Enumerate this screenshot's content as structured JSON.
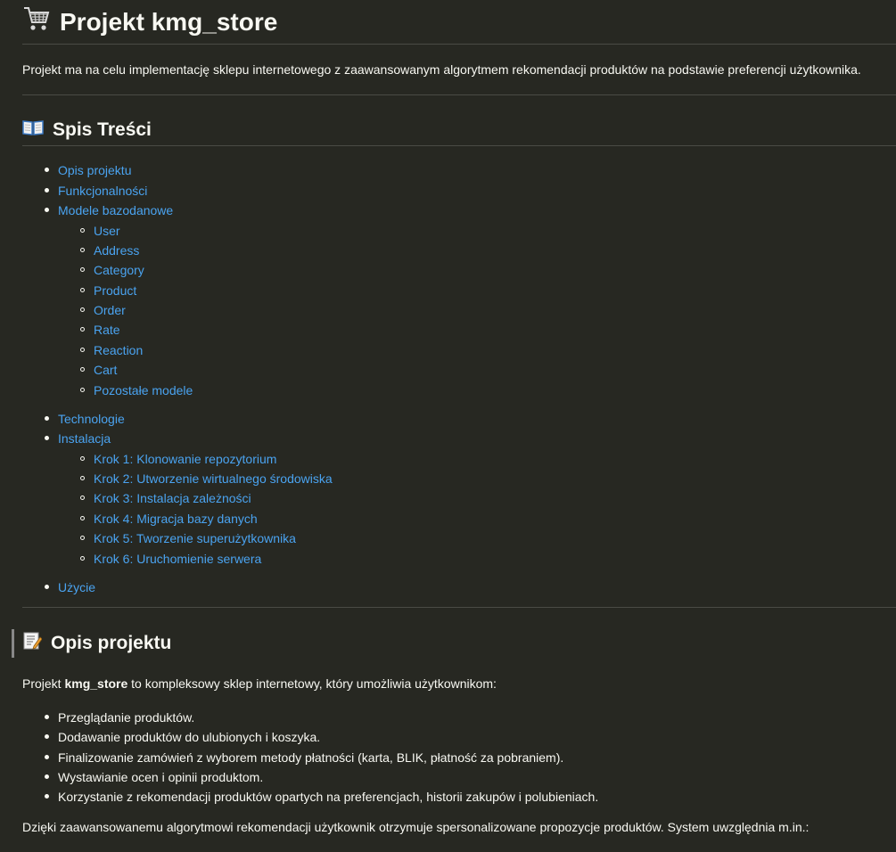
{
  "title": "Projekt kmg_store",
  "intro": "Projekt ma na celu implementację sklepu internetowego z zaawansowanym algorytmem rekomendacji produktów na podstawie preferencji użytkownika.",
  "toc": {
    "heading": "Spis Treści",
    "items": [
      {
        "label": "Opis projektu"
      },
      {
        "label": "Funkcjonalności"
      },
      {
        "label": "Modele bazodanowe"
      },
      {
        "label": "User"
      },
      {
        "label": "Address"
      },
      {
        "label": "Category"
      },
      {
        "label": "Product"
      },
      {
        "label": "Order"
      },
      {
        "label": "Rate"
      },
      {
        "label": "Reaction"
      },
      {
        "label": "Cart"
      },
      {
        "label": "Pozostałe modele"
      },
      {
        "label": "Technologie"
      },
      {
        "label": "Instalacja"
      },
      {
        "label": "Krok 1: Klonowanie repozytorium"
      },
      {
        "label": "Krok 2: Utworzenie wirtualnego środowiska"
      },
      {
        "label": "Krok 3: Instalacja zależności"
      },
      {
        "label": "Krok 4: Migracja bazy danych"
      },
      {
        "label": "Krok 5: Tworzenie superużytkownika"
      },
      {
        "label": "Krok 6: Uruchomienie serwera"
      },
      {
        "label": "Użycie"
      }
    ]
  },
  "opis": {
    "heading": "Opis projektu",
    "lead_pre": "Projekt ",
    "lead_bold": "kmg_store",
    "lead_post": " to kompleksowy sklep internetowy, który umożliwia użytkownikom:",
    "bullets": [
      "Przeglądanie produktów.",
      "Dodawanie produktów do ulubionych i koszyka.",
      "Finalizowanie zamówień z wyborem metody płatności (karta, BLIK, płatność za pobraniem).",
      "Wystawianie ocen i opinii produktom.",
      "Korzystanie z rekomendacji produktów opartych na preferencjach, historii zakupów i polubieniach."
    ],
    "closing": "Dzięki zaawansowanemu algorytmowi rekomendacji użytkownik otrzymuje spersonalizowane propozycje produktów. System uwzględnia m.in.:"
  }
}
